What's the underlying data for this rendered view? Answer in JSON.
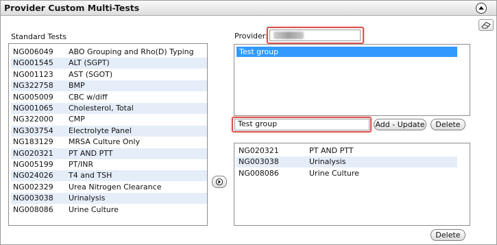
{
  "panel": {
    "title": "Provider Custom Multi-Tests",
    "collapse_icon": "chevron-up-icon",
    "clear_icon": "eraser-icon"
  },
  "standard_tests": {
    "label": "Standard Tests",
    "rows": [
      {
        "code": "NG006049",
        "name": "ABO Grouping and Rho(D) Typing"
      },
      {
        "code": "NG001545",
        "name": "ALT (SGPT)"
      },
      {
        "code": "NG001123",
        "name": "AST (SGOT)"
      },
      {
        "code": "NG322758",
        "name": "BMP"
      },
      {
        "code": "NG005009",
        "name": "CBC w/diff"
      },
      {
        "code": "NG001065",
        "name": "Cholesterol, Total"
      },
      {
        "code": "NG322000",
        "name": "CMP"
      },
      {
        "code": "NG303754",
        "name": "Electrolyte Panel"
      },
      {
        "code": "NG183129",
        "name": "MRSA Culture Only"
      },
      {
        "code": "NG020321",
        "name": "PT AND PTT"
      },
      {
        "code": "NG005199",
        "name": "PT/INR"
      },
      {
        "code": "NG024026",
        "name": "T4 and TSH"
      },
      {
        "code": "NG002329",
        "name": "Urea Nitrogen Clearance"
      },
      {
        "code": "NG003038",
        "name": "Urinalysis"
      },
      {
        "code": "NG008086",
        "name": "Urine Culture"
      }
    ]
  },
  "provider": {
    "label": "Provider:",
    "value_redacted": true
  },
  "groups": {
    "items": [
      "Test group"
    ],
    "selected_index": 0
  },
  "group_name_input": {
    "value": "Test group"
  },
  "buttons": {
    "add_update": "Add - Update",
    "delete_group": "Delete",
    "delete_test": "Delete",
    "move_icon": "arrow-right-icon"
  },
  "selected_tests": {
    "rows": [
      {
        "code": "NG020321",
        "name": "PT AND PTT"
      },
      {
        "code": "NG003038",
        "name": "Urinalysis"
      },
      {
        "code": "NG008086",
        "name": "Urine Culture"
      }
    ]
  },
  "colors": {
    "selection": "#3399ff",
    "alt_row": "#e5edf9",
    "highlight": "#d9534f"
  }
}
